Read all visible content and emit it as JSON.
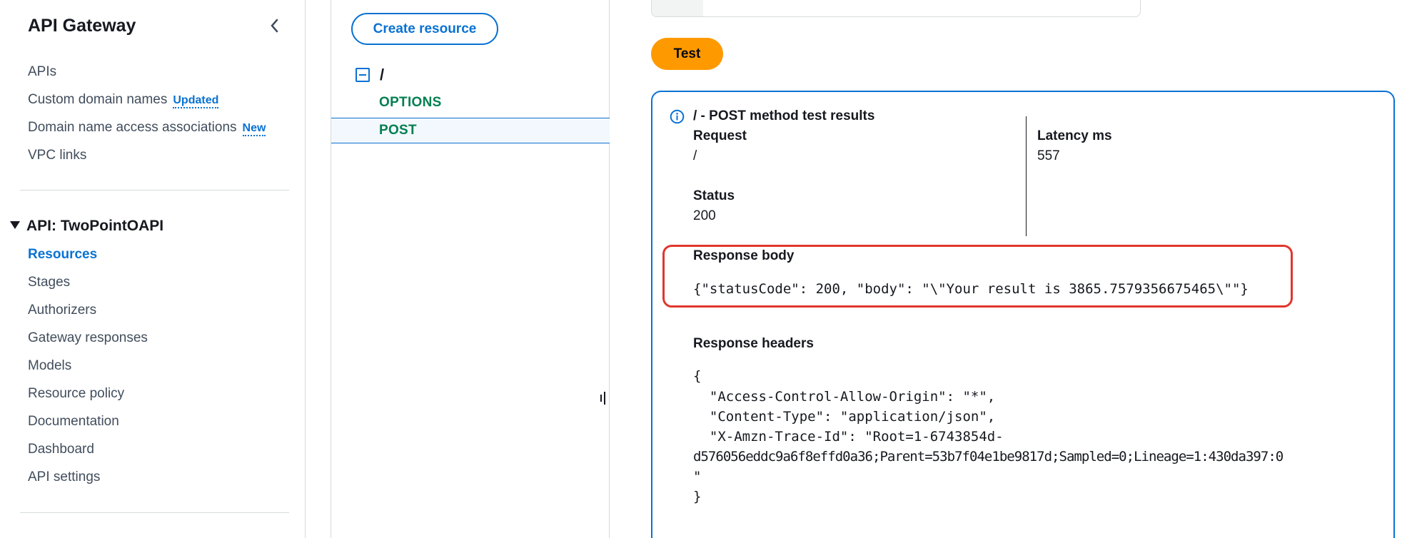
{
  "sidebar": {
    "title": "API Gateway",
    "links": [
      {
        "label": "APIs",
        "badge": ""
      },
      {
        "label": "Custom domain names",
        "badge": "Updated"
      },
      {
        "label": "Domain name access associations",
        "badge": "New"
      },
      {
        "label": "VPC links",
        "badge": ""
      }
    ],
    "api_section": "API: TwoPointOAPI",
    "api_items": [
      "Resources",
      "Stages",
      "Authorizers",
      "Gateway responses",
      "Models",
      "Resource policy",
      "Documentation",
      "Dashboard",
      "API settings"
    ]
  },
  "tree": {
    "create_label": "Create resource",
    "root": "/",
    "methods": [
      "OPTIONS",
      "POST"
    ]
  },
  "test": {
    "button_label": "Test",
    "title": "/ - POST method test results",
    "request_label": "Request",
    "request_value": "/",
    "latency_label": "Latency ms",
    "latency_value": "557",
    "status_label": "Status",
    "status_value": "200",
    "response_body_label": "Response body",
    "response_body": "{\"statusCode\": 200, \"body\": \"\\\"Your result is 3865.7579356675465\\\"\"}",
    "response_headers_label": "Response headers",
    "headers_lines": [
      "{",
      "  \"Access-Control-Allow-Origin\": \"*\",",
      "  \"Content-Type\": \"application/json\",",
      "  \"X-Amzn-Trace-Id\": \"Root=1-6743854d-",
      "d576056eddc9a6f8effd0a36;Parent=53b7f04e1be9817d;Sampled=0;Lineage=1:430da397:0",
      "\"",
      "}"
    ]
  },
  "colors": {
    "accent": "#0972d3",
    "method_green": "#037f51",
    "test_button": "#ff9900",
    "highlight_red": "#e0362c"
  }
}
